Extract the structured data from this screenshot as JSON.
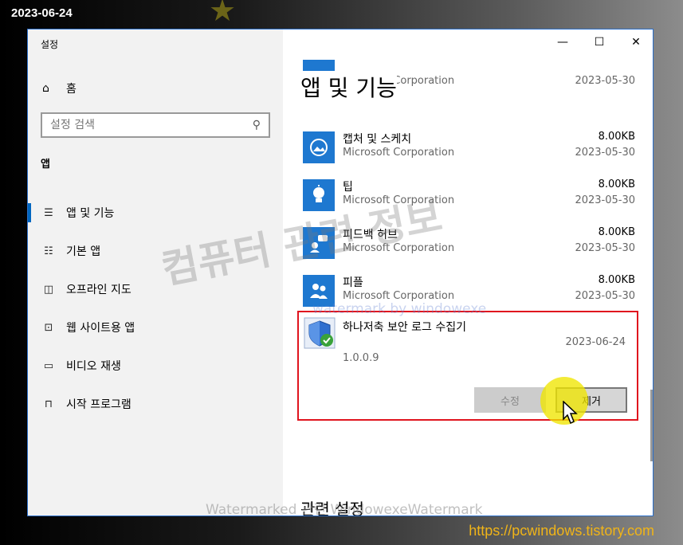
{
  "overlay": {
    "date_stamp": "2023-06-24",
    "watermark_main": "컴퓨터 관련 정보",
    "watermark_sub": "watermark by windowexe",
    "watermark_bottom": "Watermarked 관련 WindowexeWatermark",
    "url": "https://pcwindows.tistory.com",
    "highlight_color": "#f0e600"
  },
  "window": {
    "title": "설정",
    "controls": {
      "minimize": "—",
      "maximize": "☐",
      "close": "✕"
    }
  },
  "sidebar": {
    "home_label": "홈",
    "search_placeholder": "설정 검색",
    "section_label": "앱",
    "items": [
      {
        "label": "앱 및 기능",
        "icon": "apps-features-icon",
        "active": true
      },
      {
        "label": "기본 앱",
        "icon": "default-apps-icon",
        "active": false
      },
      {
        "label": "오프라인 지도",
        "icon": "offline-maps-icon",
        "active": false
      },
      {
        "label": "웹 사이트용 앱",
        "icon": "apps-for-websites-icon",
        "active": false
      },
      {
        "label": "비디오 재생",
        "icon": "video-playback-icon",
        "active": false
      },
      {
        "label": "시작 프로그램",
        "icon": "startup-icon",
        "active": false
      }
    ]
  },
  "main": {
    "title": "앱 및 기능",
    "apps": [
      {
        "name": "",
        "publisher": "Microsoft Corporation",
        "size": "",
        "date": "2023-05-30",
        "icon": "app-icon"
      },
      {
        "name": "캡처 및 스케치",
        "publisher": "Microsoft Corporation",
        "size": "8.00KB",
        "date": "2023-05-30",
        "icon": "snip-sketch-icon"
      },
      {
        "name": "팁",
        "publisher": "Microsoft Corporation",
        "size": "8.00KB",
        "date": "2023-05-30",
        "icon": "tips-icon"
      },
      {
        "name": "피드백 허브",
        "publisher": "Microsoft Corporation",
        "size": "8.00KB",
        "date": "2023-05-30",
        "icon": "feedback-hub-icon"
      },
      {
        "name": "피플",
        "publisher": "Microsoft Corporation",
        "size": "8.00KB",
        "date": "2023-05-30",
        "icon": "people-icon"
      }
    ],
    "selected_app": {
      "name": "하나저축 보안 로그 수집기",
      "date": "2023-06-24",
      "version": "1.0.0.9",
      "modify_label": "수정",
      "remove_label": "제거"
    },
    "related_settings": "관련 설정",
    "accent_color": "#0067c0",
    "selection_border_color": "#e0141e"
  }
}
